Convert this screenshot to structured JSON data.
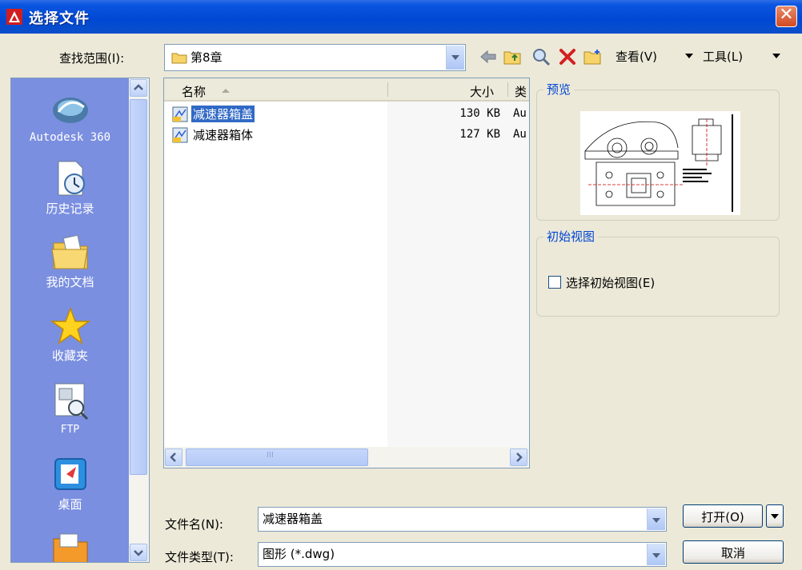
{
  "window": {
    "title": "选择文件",
    "close_glyph": "✕",
    "accent": "#0a55e0"
  },
  "lookin": {
    "label": "查找范围(I):",
    "value": "第8章"
  },
  "toolbar": {
    "icons": [
      "back-icon",
      "up-folder-icon",
      "search-web-icon",
      "delete-icon",
      "new-folder-icon"
    ],
    "view_label": "查看(V)",
    "tools_label": "工具(L)"
  },
  "places": {
    "items": [
      {
        "label": "Autodesk 360",
        "icon": "autodesk-360-icon"
      },
      {
        "label": "历史记录",
        "icon": "history-icon"
      },
      {
        "label": "我的文档",
        "icon": "my-documents-icon"
      },
      {
        "label": "收藏夹",
        "icon": "favorites-icon"
      },
      {
        "label": "FTP",
        "icon": "ftp-icon"
      },
      {
        "label": "桌面",
        "icon": "desktop-icon"
      }
    ]
  },
  "file_list": {
    "columns": {
      "name": "名称",
      "size": "大小",
      "type": "类"
    },
    "rows": [
      {
        "name": "减速器箱盖",
        "size": "130 KB",
        "type": "Au",
        "selected": true
      },
      {
        "name": "减速器箱体",
        "size": "127 KB",
        "type": "Au",
        "selected": false
      }
    ],
    "hscroll_grip": "III"
  },
  "preview": {
    "title": "预览"
  },
  "initial_view": {
    "title": "初始视图",
    "checkbox_label": "选择初始视图(E)",
    "checked": false
  },
  "filename": {
    "label": "文件名(N):",
    "value": "减速器箱盖"
  },
  "filetype": {
    "label": "文件类型(T):",
    "value": "图形 (*.dwg)"
  },
  "buttons": {
    "open": "打开(O)",
    "cancel": "取消"
  }
}
